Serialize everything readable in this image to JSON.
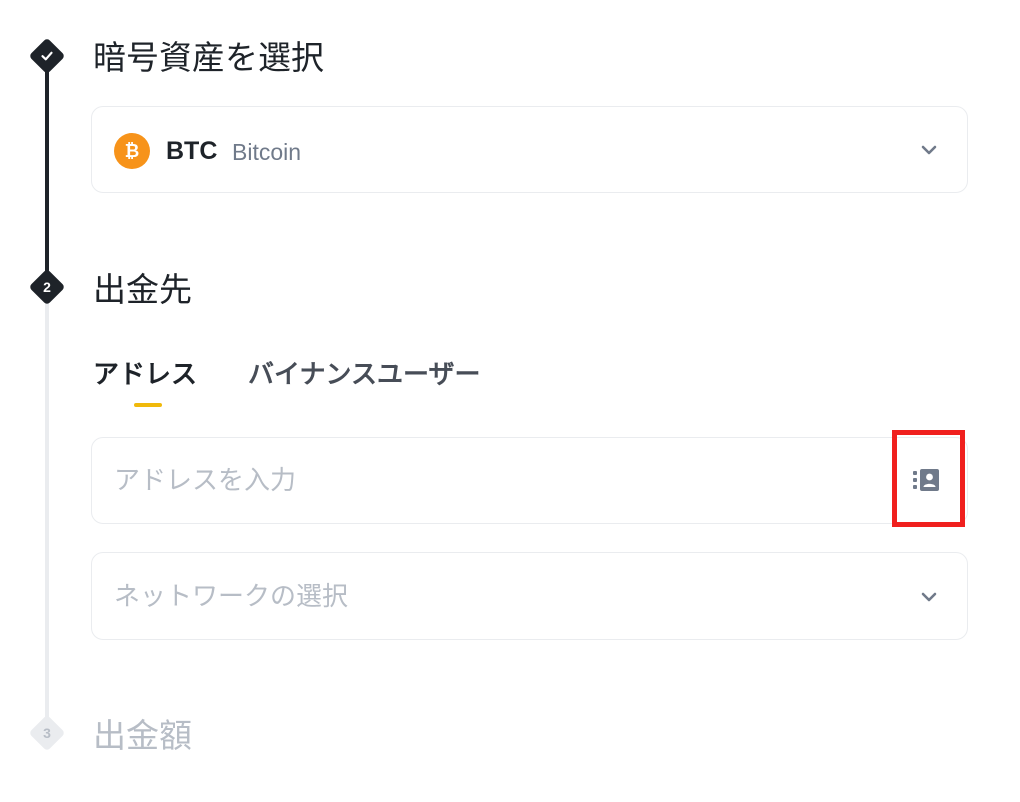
{
  "steps": [
    {
      "number": "✓",
      "title": "暗号資産を選択",
      "state": "done"
    },
    {
      "number": "2",
      "title": "出金先",
      "state": "active"
    },
    {
      "number": "3",
      "title": "出金額",
      "state": "inactive"
    }
  ],
  "coin_select": {
    "symbol": "BTC",
    "name": "Bitcoin",
    "icon": "bitcoin-icon",
    "icon_color": "#f7931a"
  },
  "tabs": [
    {
      "label": "アドレス",
      "active": true
    },
    {
      "label": "バイナンスユーザー",
      "active": false
    }
  ],
  "address_input": {
    "value": "",
    "placeholder": "アドレスを入力",
    "icon": "address-book-icon"
  },
  "network_select": {
    "placeholder": "ネットワークの選択",
    "icon": "chevron-down-icon"
  },
  "colors": {
    "accent": "#f0b90b",
    "text_primary": "#1e2329",
    "text_disabled": "#b7bdc6",
    "border": "#eaecef",
    "highlight": "#f0201e"
  }
}
